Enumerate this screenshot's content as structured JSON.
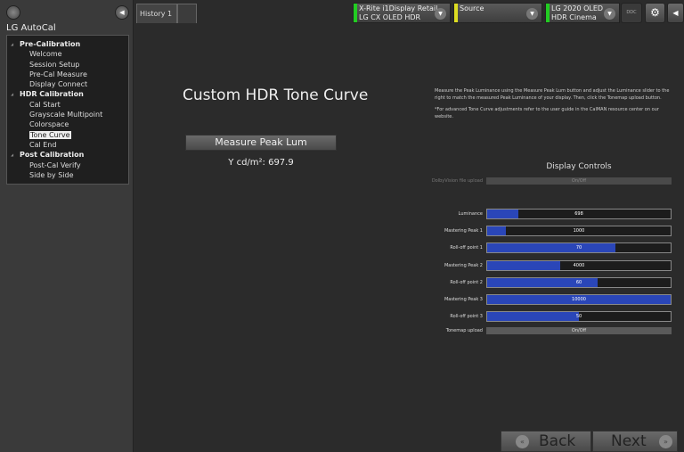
{
  "app": {
    "title": "LG AutoCal"
  },
  "tree": [
    {
      "group": "Pre-Calibration",
      "items": [
        "Welcome",
        "Session Setup",
        "Pre-Cal Measure",
        "Display  Connect"
      ]
    },
    {
      "group": "HDR Calibration",
      "items": [
        "Cal Start",
        "Grayscale Multipoint",
        "Colorspace",
        "Tone Curve",
        "Cal End"
      ]
    },
    {
      "group": "Post Calibration",
      "items": [
        "Post-Cal Verify",
        "Side by Side"
      ]
    }
  ],
  "selected_item": "Tone Curve",
  "tabs": {
    "history": "History 1"
  },
  "devices": {
    "meter": {
      "line1": "X-Rite i1Display Retail",
      "line2": "LG CX OLED HDR",
      "status_color": "#22cc22"
    },
    "source": {
      "line1": "Source",
      "line2": "",
      "status_color": "#dddd22"
    },
    "display": {
      "line1": "LG 2020 OLED",
      "line2": "HDR Cinema",
      "status_color": "#22cc22"
    },
    "ddc_label": "DDC"
  },
  "page": {
    "title": "Custom HDR Tone Curve",
    "measure_button": "Measure Peak Lum",
    "y_readout": "Y cd/m²: 697.9",
    "instructions": "Measure the Peak Luminance using the Measure Peak Lum button and adjust the Luminance slider to the right to match the measured Peak Luminance of your display.  Then, click the Tonemap upload button.",
    "note": "*For advanced Tone Curve adjustments refer to the user guide in the CalMAN resource center on our website."
  },
  "controls": {
    "title": "Display Controls",
    "dolby": {
      "label": "DolbyVision file upload",
      "value": "On/Off"
    },
    "sliders": [
      {
        "label": "Luminance",
        "value": "698",
        "fill": 0.17
      },
      {
        "label": "Mastering Peak 1",
        "value": "1000",
        "fill": 0.1
      },
      {
        "label": "Roll-off point 1",
        "value": "70",
        "fill": 0.7
      },
      {
        "label": "Mastering Peak 2",
        "value": "4000",
        "fill": 0.4
      },
      {
        "label": "Roll-off point 2",
        "value": "60",
        "fill": 0.6
      },
      {
        "label": "Mastering Peak 3",
        "value": "10000",
        "fill": 1.0
      },
      {
        "label": "Roll-off point 3",
        "value": "50",
        "fill": 0.5
      }
    ],
    "tonemap": {
      "label": "Tonemap upload",
      "value": "On/Off"
    },
    "accent": "#2a46b8"
  },
  "nav": {
    "back": "Back",
    "next": "Next"
  }
}
